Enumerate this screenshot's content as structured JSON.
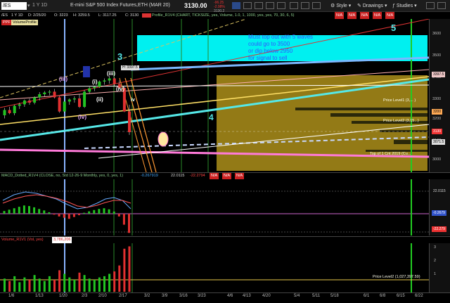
{
  "toolbar": {
    "symbol": "/ES",
    "period": "1 Y 1D",
    "date": "D: 2/25/20",
    "open": "O: 3223",
    "high": "H: 3259.5",
    "low": "L: 3117.25",
    "close": "C: 3130",
    "desc": "E-mini S&P 500 Index Futures,ETH (MAR 20)",
    "price": "3130.00",
    "chg_line1": "-96.25",
    "chg_line2": "-2.98%",
    "chg_line3": "3130.2",
    "menu": [
      "Style",
      "Drawings",
      "Studies"
    ]
  },
  "infobar": {
    "study_tag": "Profile_R1V4 (CHART, TICKSIZE, yes, Volume, 1.0, 1, 1000, yes, yes, 70, 30, 6, 5)",
    "na": [
      "N/A",
      "N/A",
      "N/A",
      "N/A",
      "N/A"
    ]
  },
  "volumeprofile_tag": "VolumeProfile",
  "annotations": {
    "box_text": [
      "Must top out with 5 waves",
      "could go to 3500",
      "or dip below 2950",
      "for signal to sell"
    ],
    "wave_3": "3",
    "wave_4": "4",
    "wave_5": "5",
    "wave_iii_left": "(iii)",
    "wave_i": "(i)",
    "wave_ii": "(ii)",
    "wave_iii": "(iii)",
    "wave_iv": "(iv)",
    "wave_iv_lower": "(iv)",
    "wave_iv_right": "iv",
    "price_tag": "H: 3397.5",
    "pl_level1": "Price Level1 (3,... )",
    "pl_level2": "Price Level2 (3,15...)",
    "top_label": "Top of 1 Cnt 2019 (Cu...",
    "price_level_bottom": "Price Level2 (1,027,397.59)"
  },
  "price_axis": {
    "ticks": [
      "3600",
      "3500",
      "3400",
      "3300",
      "3200",
      "3100",
      "3000"
    ],
    "badges": [
      {
        "text": "3397.5",
        "color": "#f0c8c8",
        "fg": "#000"
      },
      {
        "text": "3200",
        "color": "#ffaa55",
        "fg": "#000"
      },
      {
        "text": "3130",
        "color": "#e33",
        "fg": "#fff"
      },
      {
        "text": "3071.5",
        "color": "#ddd",
        "fg": "#000"
      }
    ]
  },
  "macd": {
    "label": "MACD_Dotted_R1V4 (CLOSE, no, Std 12-26-9 Monthly, yes, 0, yes, 1)",
    "v1": "-0.267919",
    "v2": "22.0115",
    "v3": "-22.2794",
    "na": [
      "N/A",
      "N/A",
      "N/A"
    ],
    "axis_badges": [
      "22.0115",
      "-0.2679",
      "-22.279"
    ]
  },
  "volume": {
    "label": "Volume_R1V1 (Vol, yes)",
    "value": "3,786,206",
    "axis_ticks": [
      "3",
      "2",
      "1"
    ]
  },
  "dates": [
    "1/6",
    "1/13",
    "1/20",
    "2/3",
    "2/10",
    "2/17",
    "3/2",
    "3/9",
    "3/16",
    "3/23",
    "4/6",
    "4/13",
    "4/20",
    "5/4",
    "5/11",
    "5/18",
    "6/1",
    "6/8",
    "6/15",
    "6/22"
  ],
  "chart_data": {
    "type": "candlestick",
    "title": "E-mini S&P 500 Index Futures,ETH (MAR 20)",
    "ylim": [
      2950,
      3650
    ],
    "last_price": 3130,
    "high_marked": 3397.5,
    "candles": [
      {
        "o": 3210,
        "h": 3245,
        "l": 3195,
        "c": 3235
      },
      {
        "o": 3235,
        "h": 3250,
        "l": 3215,
        "c": 3220
      },
      {
        "o": 3220,
        "h": 3260,
        "l": 3210,
        "c": 3255
      },
      {
        "o": 3255,
        "h": 3270,
        "l": 3240,
        "c": 3262
      },
      {
        "o": 3262,
        "h": 3285,
        "l": 3250,
        "c": 3280
      },
      {
        "o": 3280,
        "h": 3290,
        "l": 3260,
        "c": 3270
      },
      {
        "o": 3270,
        "h": 3300,
        "l": 3262,
        "c": 3295
      },
      {
        "o": 3295,
        "h": 3320,
        "l": 3280,
        "c": 3310
      },
      {
        "o": 3310,
        "h": 3325,
        "l": 3300,
        "c": 3318
      },
      {
        "o": 3318,
        "h": 3330,
        "l": 3305,
        "c": 3322
      },
      {
        "o": 3322,
        "h": 3335,
        "l": 3290,
        "c": 3295
      },
      {
        "o": 3295,
        "h": 3300,
        "l": 3222,
        "c": 3228
      },
      {
        "o": 3228,
        "h": 3280,
        "l": 3220,
        "c": 3275
      },
      {
        "o": 3275,
        "h": 3290,
        "l": 3260,
        "c": 3285
      },
      {
        "o": 3285,
        "h": 3300,
        "l": 3270,
        "c": 3290
      },
      {
        "o": 3290,
        "h": 3310,
        "l": 3245,
        "c": 3250
      },
      {
        "o": 3250,
        "h": 3330,
        "l": 3245,
        "c": 3322
      },
      {
        "o": 3322,
        "h": 3345,
        "l": 3315,
        "c": 3338
      },
      {
        "o": 3338,
        "h": 3350,
        "l": 3325,
        "c": 3345
      },
      {
        "o": 3345,
        "h": 3375,
        "l": 3340,
        "c": 3370
      },
      {
        "o": 3370,
        "h": 3385,
        "l": 3355,
        "c": 3375
      },
      {
        "o": 3375,
        "h": 3397.5,
        "l": 3360,
        "c": 3385
      },
      {
        "o": 3385,
        "h": 3390,
        "l": 3350,
        "c": 3358
      },
      {
        "o": 3358,
        "h": 3375,
        "l": 3335,
        "c": 3340
      },
      {
        "o": 3340,
        "h": 3345,
        "l": 3225,
        "c": 3228
      },
      {
        "o": 3228,
        "h": 3259.5,
        "l": 3117.25,
        "c": 3130
      }
    ],
    "volume": [
      1.1,
      0.9,
      1.3,
      0.8,
      1.2,
      1.0,
      1.4,
      1.1,
      0.9,
      1.3,
      1.0,
      1.8,
      1.5,
      1.2,
      1.0,
      1.6,
      1.4,
      1.1,
      1.0,
      1.2,
      1.3,
      1.5,
      1.7,
      2.2,
      3.6,
      3.8
    ],
    "macd_hist": [
      1.5,
      2.2,
      3.0,
      3.8,
      4.5,
      4.2,
      3.5,
      2.6,
      1.8,
      0.8,
      -0.5,
      -1.5,
      -2.2,
      -2.8,
      -1.8,
      -0.8,
      0.5,
      1.3,
      2.0,
      2.6,
      3.0,
      2.4,
      1.2,
      -1.5,
      -6.0,
      -10.5
    ]
  }
}
